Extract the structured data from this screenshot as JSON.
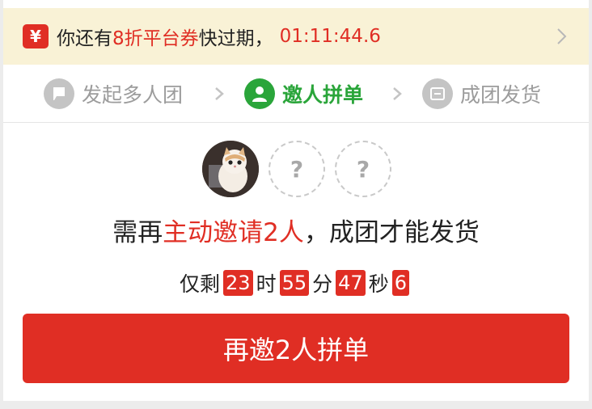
{
  "notice": {
    "badge_glyph": "¥",
    "prefix": "你还有",
    "highlight": "8折平台券",
    "suffix": "快过期，",
    "countdown": "01:11:44.6"
  },
  "steps": [
    {
      "label": "发起多人团",
      "icon": "flag-icon",
      "state": "done"
    },
    {
      "label": "邀人拼单",
      "icon": "person-icon",
      "state": "active"
    },
    {
      "label": "成团发货",
      "icon": "box-icon",
      "state": "pending"
    }
  ],
  "avatars": {
    "empty_placeholder": "?"
  },
  "headline": {
    "prefix": "需再",
    "highlight": "主动邀请2人",
    "suffix": "，成团才能发货"
  },
  "timer": {
    "prefix": "仅剩",
    "hours": "23",
    "hours_unit": "时",
    "minutes": "55",
    "minutes_unit": "分",
    "seconds": "47",
    "seconds_unit": "秒",
    "tenths": "6"
  },
  "cta": {
    "label": "再邀2人拼单"
  },
  "colors": {
    "brand_red": "#e02e24",
    "active_green": "#2aa53a",
    "notice_bg": "#f9f2d6",
    "inactive_gray": "#9c9c9c"
  }
}
